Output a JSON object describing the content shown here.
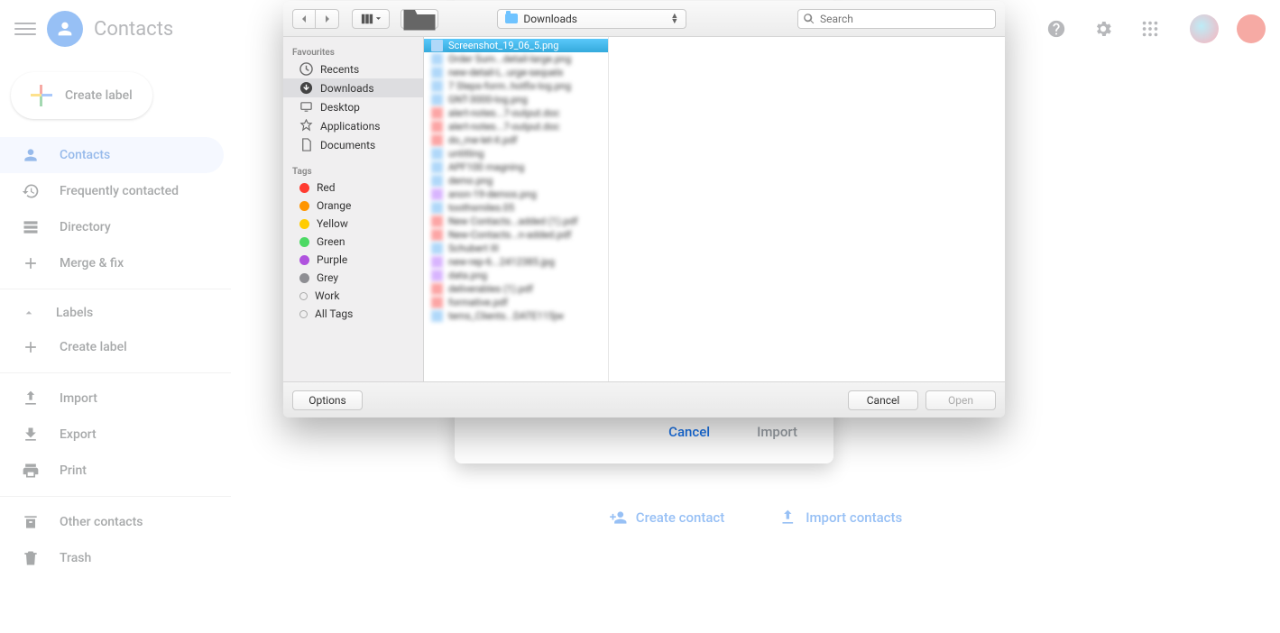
{
  "app": {
    "title": "Contacts"
  },
  "topbar": {
    "search_placeholder": "Search"
  },
  "sidebar": {
    "create_label": "Create label",
    "items": {
      "contacts": "Contacts",
      "frequent": "Frequently contacted",
      "directory": "Directory",
      "merge": "Merge & fix"
    },
    "labels_header": "Labels",
    "create_label_label": "Create label",
    "import": "Import",
    "export": "Export",
    "print": "Print",
    "other": "Other contacts",
    "trash": "Trash"
  },
  "content": {
    "create_contact": "Create contact",
    "import_contacts": "Import contacts"
  },
  "import_dialog": {
    "cancel": "Cancel",
    "import": "Import"
  },
  "file_picker": {
    "location_label": "Downloads",
    "search_placeholder": "Search",
    "sidebar": {
      "favourites_label": "Favourites",
      "favourites": {
        "recents": "Recents",
        "downloads": "Downloads",
        "desktop": "Desktop",
        "applications": "Applications",
        "documents": "Documents"
      },
      "tags_label": "Tags",
      "tags": {
        "red": {
          "label": "Red",
          "color": "#ff3b30"
        },
        "orange": {
          "label": "Orange",
          "color": "#ff9500"
        },
        "yellow": {
          "label": "Yellow",
          "color": "#ffcc00"
        },
        "green": {
          "label": "Green",
          "color": "#4cd964"
        },
        "purple": {
          "label": "Purple",
          "color": "#af52de"
        },
        "grey": {
          "label": "Grey",
          "color": "#8e8e93"
        },
        "work": {
          "label": "Work"
        },
        "all": {
          "label": "All Tags"
        }
      }
    },
    "files": [
      {
        "name": "Screenshot_19_06_5.png",
        "type": "png",
        "selected": true
      },
      {
        "name": "Order Sum...detail-large.png",
        "type": "png"
      },
      {
        "name": "new-detail-L..urge-sequelx",
        "type": "png"
      },
      {
        "name": "7 Steps-form..hotfix-log.png",
        "type": "png"
      },
      {
        "name": "GNT-3000-log.png",
        "type": "png"
      },
      {
        "name": "alert-notes...7-output.doc",
        "type": "pdf"
      },
      {
        "name": "alert-notes...7-output.doc",
        "type": "pdf"
      },
      {
        "name": "do_me-let-it.pdf",
        "type": "pdf"
      },
      {
        "name": "untitling",
        "type": "png"
      },
      {
        "name": "APF100 magning",
        "type": "png"
      },
      {
        "name": "demo.png",
        "type": "png"
      },
      {
        "name": "anon-19-demos.png",
        "type": "jpg"
      },
      {
        "name": "toothsmiles.05",
        "type": "png"
      },
      {
        "name": "New Contacts...added (1).pdf",
        "type": "pdf"
      },
      {
        "name": "New-Contacts...n-added.pdf",
        "type": "pdf"
      },
      {
        "name": "Schubert III",
        "type": "png"
      },
      {
        "name": "new-rep-6...2412385.jpg",
        "type": "jpg"
      },
      {
        "name": "data.png",
        "type": "jpg"
      },
      {
        "name": "deliverables (1).pdf",
        "type": "pdf"
      },
      {
        "name": "formative.pdf",
        "type": "pdf"
      },
      {
        "name": "tems_Clients...DATE115jw",
        "type": "png"
      }
    ],
    "footer": {
      "options": "Options",
      "cancel": "Cancel",
      "open": "Open"
    }
  }
}
